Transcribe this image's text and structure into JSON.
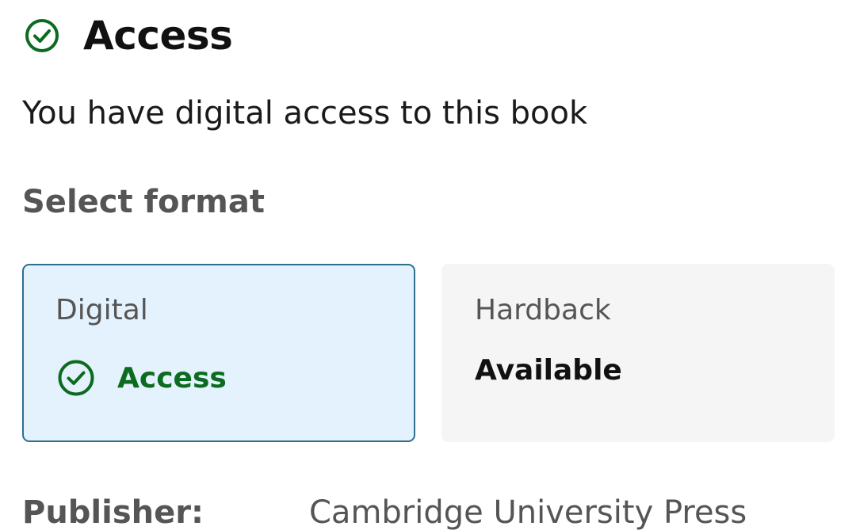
{
  "access": {
    "title": "Access",
    "icon": "check-circle-icon",
    "color": "#0b6b1f"
  },
  "lead_text": "You have digital access to this book",
  "select_format_label": "Select format",
  "formats": [
    {
      "name": "Digital",
      "status": "Access",
      "status_icon": "check-circle-icon",
      "selected": true
    },
    {
      "name": "Hardback",
      "status": "Available",
      "selected": false
    }
  ],
  "details": {
    "publisher_label": "Publisher:",
    "publisher_value": "Cambridge University Press"
  },
  "colors": {
    "selected_bg": "#e4f2fd",
    "selected_border": "#2c6f93",
    "unselected_bg": "#f5f5f5",
    "access_green": "#0b6b1f"
  }
}
